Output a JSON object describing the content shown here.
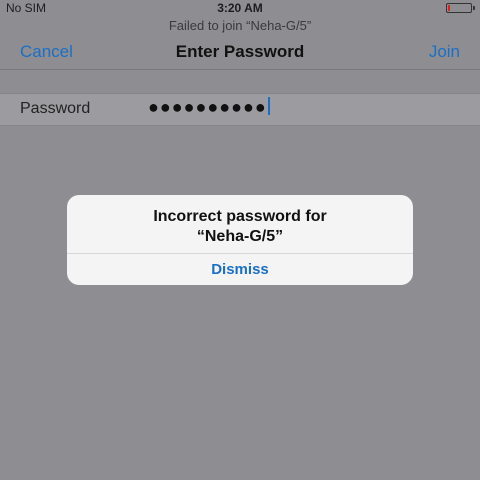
{
  "status_bar": {
    "carrier": "No SIM",
    "time": "3:20 AM",
    "battery_icon": "battery-low-icon"
  },
  "join_prompt": "Failed to join “Neha-G/5”",
  "nav": {
    "cancel_label": "Cancel",
    "title": "Enter Password",
    "join_label": "Join"
  },
  "form": {
    "password_label": "Password",
    "password_masked": "●●●●●●●●●●"
  },
  "alert": {
    "message_line1": "Incorrect password for",
    "message_line2": "“Neha-G/5”",
    "dismiss_label": "Dismiss"
  },
  "colors": {
    "accent": "#1b6fc4",
    "overlay": "#8e8e92"
  }
}
